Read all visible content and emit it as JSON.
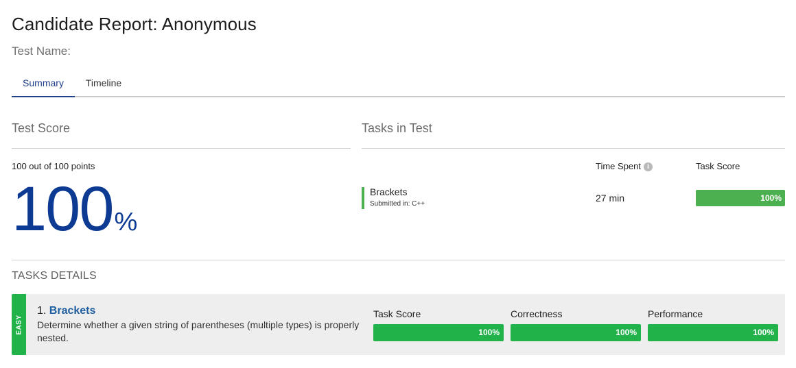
{
  "header": {
    "title": "Candidate Report: Anonymous",
    "test_name_label": "Test Name:"
  },
  "tabs": [
    {
      "label": "Summary",
      "active": true
    },
    {
      "label": "Timeline",
      "active": false
    }
  ],
  "test_score": {
    "heading": "Test Score",
    "points_text": "100 out of 100 points",
    "score": "100",
    "percent_sign": "%",
    "accent_color": "#0d3a92"
  },
  "tasks_in_test": {
    "heading": "Tasks in Test",
    "col_time": "Time Spent",
    "col_score": "Task Score",
    "info_icon": "info-icon",
    "tasks": [
      {
        "name": "Brackets",
        "submitted": "Submitted in: C++",
        "time": "27 min",
        "score_label": "100%",
        "score_fraction": 1.0
      }
    ]
  },
  "tasks_details": {
    "heading": "TASKS DETAILS",
    "items": [
      {
        "difficulty": "EASY",
        "number": "1.",
        "name": "Brackets",
        "description": "Determine whether a given string of parentheses (multiple types) is properly nested.",
        "metrics": [
          {
            "label": "Task Score",
            "value": "100%",
            "fraction": 1.0
          },
          {
            "label": "Correctness",
            "value": "100%",
            "fraction": 1.0
          },
          {
            "label": "Performance",
            "value": "100%",
            "fraction": 1.0
          }
        ]
      }
    ]
  },
  "colors": {
    "success": "#22b24a",
    "success_light": "#4caf50",
    "link": "#1f5fa0"
  }
}
